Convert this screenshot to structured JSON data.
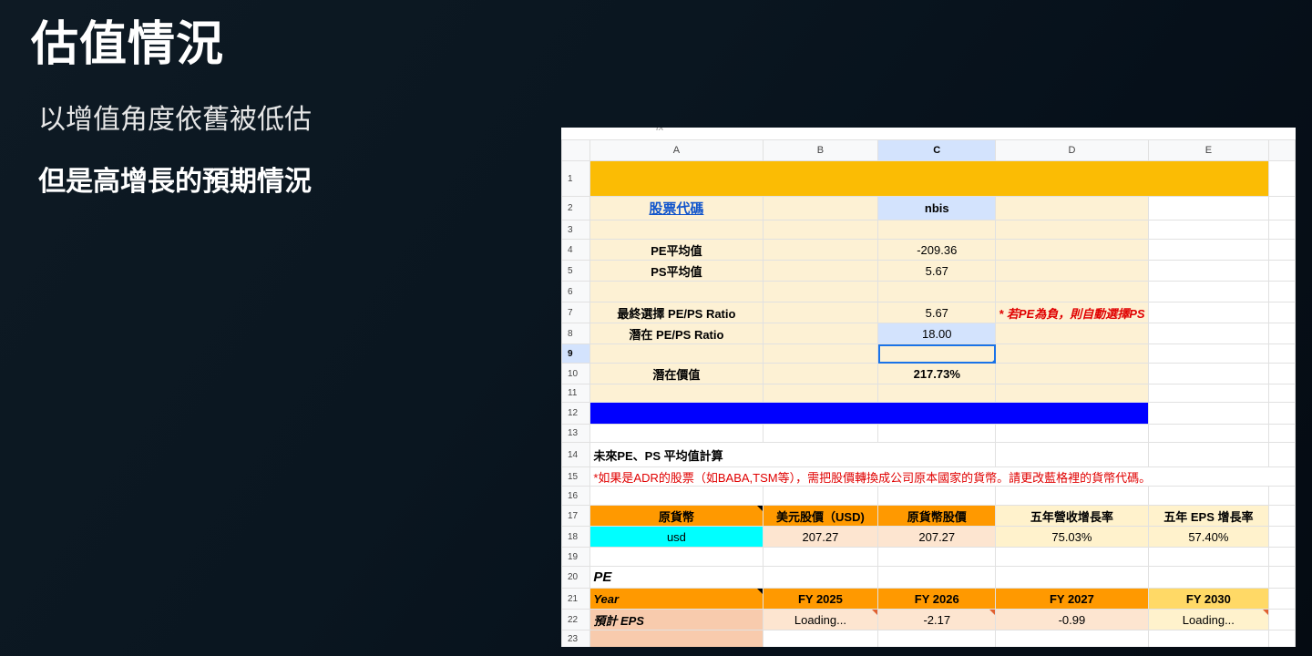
{
  "slide": {
    "title": "估值情況",
    "subtitle1": "以增值角度依舊被低估",
    "subtitle2": "但是高增長的預期情況"
  },
  "sheet": {
    "columns": [
      "A",
      "B",
      "C",
      "D",
      "E"
    ],
    "rows": {
      "r2": {
        "a": "股票代碼",
        "c": "nbis"
      },
      "r4": {
        "a": "PE平均值",
        "c": "-209.36"
      },
      "r5": {
        "a": "PS平均值",
        "c": "5.67"
      },
      "r7": {
        "a": "最終選擇 PE/PS Ratio",
        "c": "5.67",
        "d": "* 若PE為負，則自動選擇PS"
      },
      "r8": {
        "a": "潛在 PE/PS Ratio",
        "c": "18.00"
      },
      "r10": {
        "a": "潛在價值",
        "c": "217.73%"
      },
      "r14": {
        "a": "未來PE、PS 平均值計算"
      },
      "r15": {
        "a": "*如果是ADR的股票（如BABA,TSM等），需把股價轉換成公司原本國家的貨幣。請更改藍格裡的貨幣代碼。"
      },
      "r17": {
        "a": "原貨幣",
        "b": "美元股價（USD)",
        "c": "原貨幣股價",
        "d": "五年營收增長率",
        "e": "五年 EPS 增長率"
      },
      "r18": {
        "a": "usd",
        "b": "207.27",
        "c": "207.27",
        "d": "75.03%",
        "e": "57.40%"
      },
      "r20": {
        "a": "PE"
      },
      "r21": {
        "a": "Year",
        "b": "FY 2025",
        "c": "FY 2026",
        "d": "FY 2027",
        "e": "FY 2030"
      },
      "r22": {
        "a": "預計 EPS",
        "b": "Loading...",
        "c": "-2.17",
        "d": "-0.99",
        "e": "Loading..."
      }
    }
  },
  "colors": {
    "header_yellow": "#fbbc04",
    "blue_bar": "#0000ff",
    "selection": "#d3e3fd",
    "orange": "#ff9900"
  }
}
